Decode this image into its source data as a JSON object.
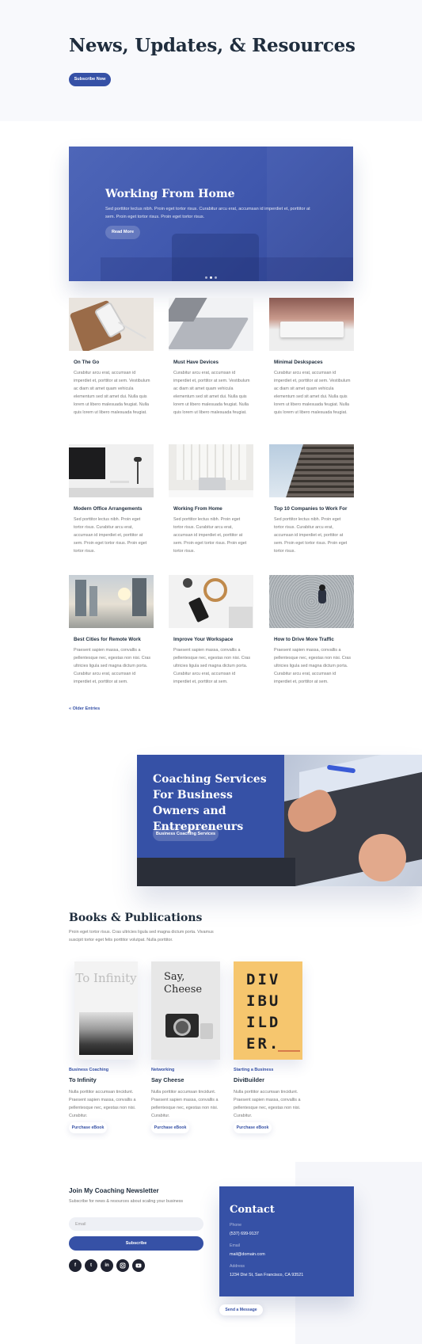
{
  "header": {
    "title": "News, Updates, & Resources",
    "subscribe_label": "Subscribe Now"
  },
  "hero": {
    "title": "Working From Home",
    "text": "Sed porttitor lectus nibh. Proin eget tortor risus. Curabitur arcu erat, accumsan id imperdiet et, porttitor at sem. Proin eget tortor risus. Proin eget tortor risus.",
    "button_label": "Read More",
    "slides": 3,
    "active_slide": 1
  },
  "posts": [
    {
      "title": "On The Go",
      "excerpt": "Curabitur arcu erat, accumsan id imperdiet et, porttitor at sem. Vestibulum ac diam sit amet quam vehicula elementum sed sit amet dui. Nulla quis lorem ut libero malesuada feugiat. Nulla quis lorem ut libero malesuada feugiat."
    },
    {
      "title": "Must Have Devices",
      "excerpt": "Curabitur arcu erat, accumsan id imperdiet et, porttitor at sem. Vestibulum ac diam sit amet quam vehicula elementum sed sit amet dui. Nulla quis lorem ut libero malesuada feugiat. Nulla quis lorem ut libero malesuada feugiat."
    },
    {
      "title": "Minimal Deskspaces",
      "excerpt": "Curabitur arcu erat, accumsan id imperdiet et, porttitor at sem. Vestibulum ac diam sit amet quam vehicula elementum sed sit amet dui. Nulla quis lorem ut libero malesuada feugiat. Nulla quis lorem ut libero malesuada feugiat."
    },
    {
      "title": "Modern Office Arrangements",
      "excerpt": "Sed porttitor lectus nibh. Proin eget tortor risus. Curabitur arcu erat, accumsan id imperdiet et, porttitor at sem. Proin eget tortor risus. Proin eget tortor risus."
    },
    {
      "title": "Working From Home",
      "excerpt": "Sed porttitor lectus nibh. Proin eget tortor risus. Curabitur arcu erat, accumsan id imperdiet et, porttitor at sem. Proin eget tortor risus. Proin eget tortor risus."
    },
    {
      "title": "Top 10 Companies to Work For",
      "excerpt": "Sed porttitor lectus nibh. Proin eget tortor risus. Curabitur arcu erat, accumsan id imperdiet et, porttitor at sem. Proin eget tortor risus. Proin eget tortor risus."
    },
    {
      "title": "Best Cities for Remote Work",
      "excerpt": "Praesent sapien massa, convallis a pellentesque nec, egestas non nisi. Cras ultricies ligula sed magna dictum porta. Curabitur arcu erat, accumsan id imperdiet et, porttitor at sem."
    },
    {
      "title": "Improve Your Workspace",
      "excerpt": "Praesent sapien massa, convallis a pellentesque nec, egestas non nisi. Cras ultricies ligula sed magna dictum porta. Curabitur arcu erat, accumsan id imperdiet et, porttitor at sem."
    },
    {
      "title": "How to Drive More Traffic",
      "excerpt": "Praesent sapien massa, convallis a pellentesque nec, egestas non nisi. Cras ultricies ligula sed magna dictum porta. Curabitur arcu erat, accumsan id imperdiet et, porttitor at sem."
    }
  ],
  "older_entries_label": "« Older Entries",
  "coaching": {
    "title": "Coaching Services For Business Owners and Entrepreneurs",
    "button_label": "Business Coaching Services"
  },
  "books": {
    "title": "Books & Publications",
    "description": "Proin eget tortor risus. Cras ultricies ligula sed magna dictum porta. Vivamus suscipit tortor eget felis porttitor volutpat. Nulla porttitor.",
    "items": [
      {
        "category": "Business Coaching",
        "title": "To Infinity",
        "cover_text": "To Infinity",
        "excerpt": "Nulla porttitor accumsan tincidunt. Praesent sapien massa, convallis a pellentesque nec, egestas non nisi. Curabitur.",
        "button_label": "Purchase eBook"
      },
      {
        "category": "Networking",
        "title": "Say Cheese",
        "cover_text": "Say, Cheese",
        "excerpt": "Nulla porttitor accumsan tincidunt. Praesent sapien massa, convallis a pellentesque nec, egestas non nisi. Curabitur.",
        "button_label": "Purchase eBook"
      },
      {
        "category": "Starting a Business",
        "title": "DiviBuilder",
        "cover_text": "DIV IBU ILD ER.",
        "excerpt": "Nulla porttitor accumsan tincidunt. Praesent sapien massa, convallis a pellentesque nec, egestas non nisi. Curabitur.",
        "button_label": "Purchase eBook"
      }
    ]
  },
  "newsletter": {
    "title": "Join My Coaching Newsletter",
    "description": "Subscribe for news & resources about scaling your business",
    "email_placeholder": "Email",
    "subscribe_label": "Subscribe",
    "social": [
      "facebook-icon",
      "twitter-icon",
      "linkedin-icon",
      "instagram-icon",
      "youtube-icon"
    ]
  },
  "contact": {
    "title": "Contact",
    "phone_label": "Phone",
    "phone": "(537) 699-9137",
    "email_label": "Email",
    "email": "mail@domain.com",
    "address_label": "Address",
    "address": "1234 Divi St, San Francisco, CA 93521",
    "send_label": "Send a Message"
  },
  "colors": {
    "accent": "#3651a6",
    "heading": "#1f2d3d",
    "social_bg": "#1f2230"
  }
}
